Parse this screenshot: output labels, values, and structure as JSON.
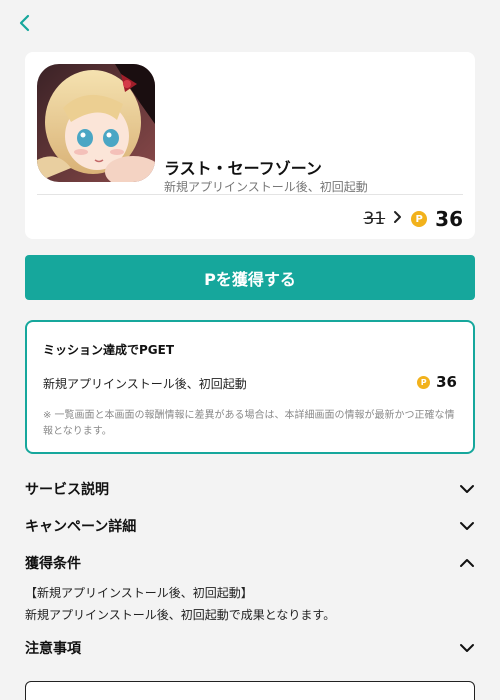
{
  "colors": {
    "accent": "#16a79c",
    "coin": "#f2b21c",
    "background": "#f3f3f3"
  },
  "nav": {
    "back_icon": "chevron-left-icon"
  },
  "app": {
    "title": "ラスト・セーフゾーン",
    "subtitle": "新規アプリインストール後、初回起動",
    "old_points": "31",
    "new_points": "36",
    "coin_symbol": "P"
  },
  "get_button_label": "Pを獲得する",
  "mission": {
    "heading": "ミッション達成でPGET",
    "item_label": "新規アプリインストール後、初回起動",
    "points": "36",
    "coin_symbol": "P",
    "note": "※ 一覧画面と本画面の報酬情報に差異がある場合は、本詳細画面の情報が最新かつ正確な情報となります。"
  },
  "sections": {
    "service": "サービス説明",
    "campaign": "キャンペーン詳細",
    "conditions": "獲得条件",
    "notes": "注意事項"
  },
  "conditions": {
    "title": "【新規アプリインストール後、初回起動】",
    "body": "新規アプリインストール後、初回起動で成果となります。"
  }
}
